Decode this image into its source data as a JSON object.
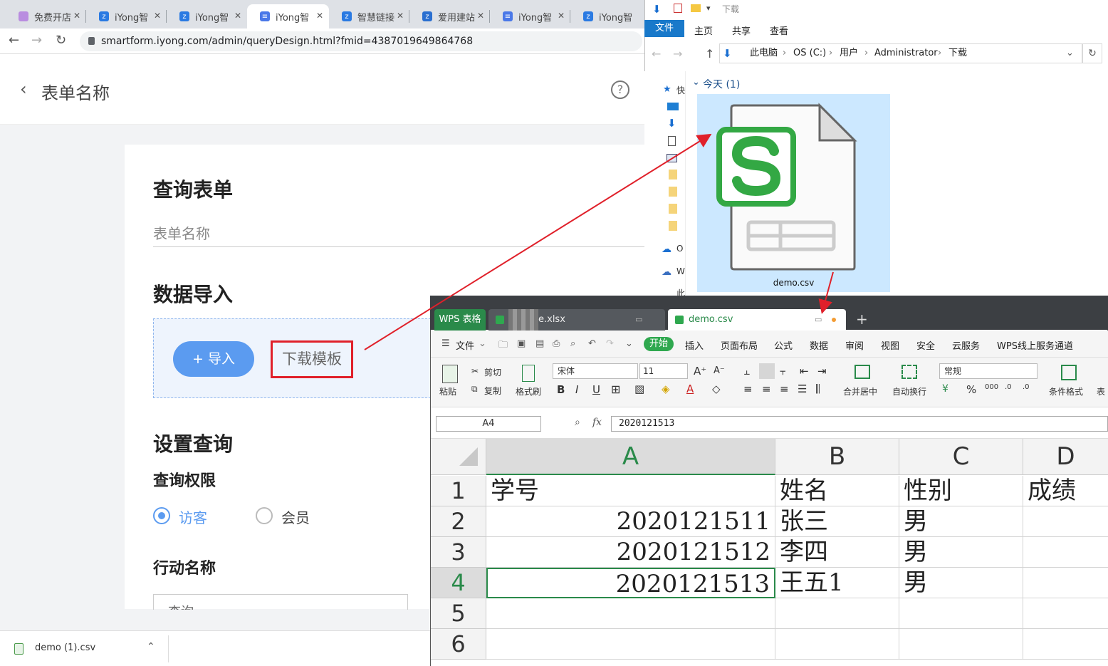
{
  "browser": {
    "tabs": [
      "免费开店",
      "iYong智",
      "iYong智",
      "iYong智",
      "智慧链接",
      "爱用建站",
      "iYong智",
      "iYong智"
    ],
    "url": "smartform.iyong.com/admin/queryDesign.html?fmid=4387019649864768"
  },
  "page": {
    "back_title": "表单名称",
    "section_query": "查询表单",
    "form_name_placeholder": "表单名称",
    "section_import": "数据导入",
    "import_btn": "+ 导入",
    "download_template": "下载模板",
    "section_settings": "设置查询",
    "permission_label": "查询权限",
    "options": [
      "访客",
      "会员"
    ],
    "selected_option": "访客",
    "action_label": "行动名称",
    "action_input": "查询"
  },
  "download_bar": {
    "file": "demo (1).csv"
  },
  "explorer": {
    "title": "下载",
    "tabs": [
      "文件",
      "主页",
      "共享",
      "查看"
    ],
    "path": [
      "此电脑",
      "OS (C:)",
      "用户",
      "Administrator",
      "下载"
    ],
    "group": "今天 (1)",
    "nav_items": [
      "快",
      "O",
      "W",
      "此"
    ],
    "file_name": "demo.csv"
  },
  "wps": {
    "brand": "WPS 表格",
    "tabs": [
      {
        "name": "xlsx",
        "label": "e.xlsx"
      },
      {
        "name": "csv",
        "label": "demo.csv"
      }
    ],
    "menus": [
      "文件",
      "开始",
      "插入",
      "页面布局",
      "公式",
      "数据",
      "审阅",
      "视图",
      "安全",
      "云服务",
      "WPS线上服务通道"
    ],
    "toolbar": {
      "paste": "粘贴",
      "cut": "剪切",
      "copy": "复制",
      "format_painter": "格式刷",
      "font": "宋体",
      "size": "11",
      "merge": "合并居中",
      "wrap": "自动换行",
      "number_format": "常规",
      "cond_format": "条件格式",
      "table_style": "表"
    },
    "namebox": "A4",
    "fx": "fx",
    "formula": "2020121513",
    "columns": [
      "A",
      "B",
      "C",
      "D"
    ],
    "rows": [
      "1",
      "2",
      "3",
      "4",
      "5",
      "6"
    ],
    "cells": [
      [
        "学号",
        "姓名",
        "性别",
        "成绩"
      ],
      [
        "2020121511",
        "张三",
        "男",
        ""
      ],
      [
        "2020121512",
        "李四",
        "男",
        ""
      ],
      [
        "2020121513",
        "王五1",
        "男",
        ""
      ],
      [
        "",
        "",
        "",
        ""
      ],
      [
        "",
        "",
        "",
        ""
      ]
    ]
  },
  "colors": {
    "accent": "#5b9bf0",
    "highlight": "#e0202a",
    "wps_green": "#2a8a4a",
    "explorer_blue": "#1979ca"
  }
}
